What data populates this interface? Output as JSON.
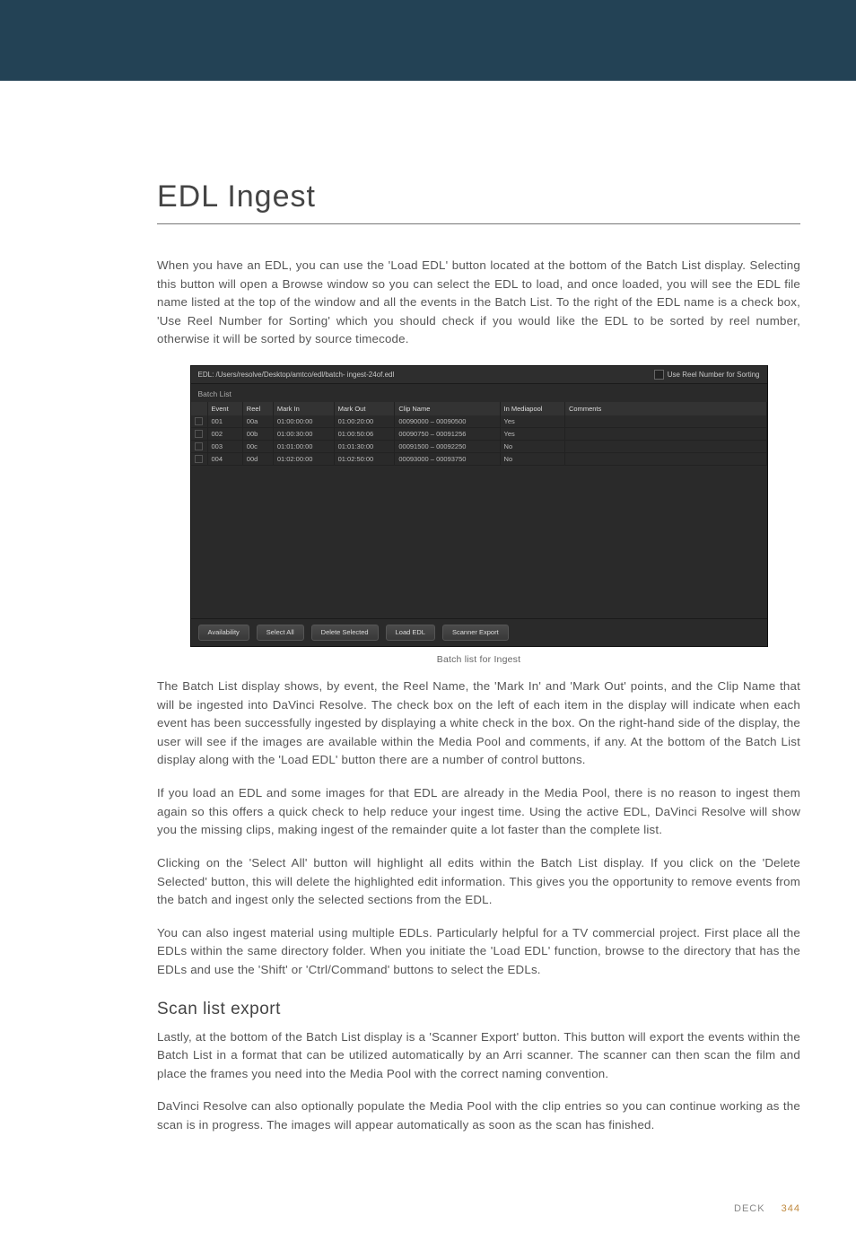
{
  "title": "EDL Ingest",
  "para1": "When you have an EDL, you can use the 'Load EDL' button located at the bottom of the Batch List display. Selecting this button will open a Browse window so you can select the EDL to load, and once loaded, you will see the EDL file name listed at the top of the window and all the events in the Batch List. To the right of the EDL name is a check box, 'Use Reel Number for Sorting' which you should check if you would like the EDL to be sorted by reel number, otherwise it will be sorted by source timecode.",
  "caption": "Batch list for Ingest",
  "para2": "The Batch List display shows, by event, the Reel Name, the 'Mark In' and 'Mark Out' points, and the Clip Name that will be ingested into DaVinci Resolve. The check box on the left of each item in the display will indicate when each event has been successfully ingested by displaying a white check in the box. On the right-hand side of the display, the user will see if the images are available within the Media Pool and comments, if any. At the bottom of the Batch List display along with the 'Load EDL' button there are a number of control buttons.",
  "para3": "If you load an EDL and some images for that EDL are already in the Media Pool, there is no reason to ingest them again so this offers a quick check to help reduce your ingest time. Using the active EDL, DaVinci Resolve will show you the missing clips, making ingest of the remainder quite a lot faster than the complete list.",
  "para4": "Clicking on the 'Select All' button will highlight all edits within the Batch List display. If you click on the 'Delete Selected' button, this will delete the highlighted edit information. This gives you the opportunity to remove events from the batch and ingest only the selected sections from the EDL.",
  "para5": "You can also ingest material using multiple EDLs. Particularly helpful for a TV commercial project. First place all the EDLs within the same directory folder. When you initiate the 'Load EDL' function, browse to the directory that has the EDLs and use the 'Shift' or 'Ctrl/Command' buttons to select the EDLs.",
  "subhead": "Scan list export",
  "para6": "Lastly, at the bottom of the Batch List display is a 'Scanner Export' button. This button will export the events within the Batch List in a format that can be utilized automatically by an Arri scanner. The scanner can then scan the film and place the frames you need into the Media Pool with the correct naming convention.",
  "para7": "DaVinci Resolve can also optionally populate the Media Pool with the clip entries so you can continue working as the scan is in progress. The images will appear automatically as soon as the scan has finished.",
  "footer": {
    "section": "DECK",
    "page": "344"
  },
  "shot": {
    "path_label": "EDL:  /Users/resolve/Desktop/amtco/edl/batch- ingest-24of.edl",
    "sort_label": "Use Reel Number for Sorting",
    "list_title": "Batch List",
    "headers": [
      "",
      "Event",
      "Reel",
      "Mark In",
      "Mark Out",
      "Clip Name",
      "In Mediapool",
      "Comments"
    ],
    "rows": [
      {
        "event": "001",
        "reel": "00a",
        "in": "01:00:00:00",
        "out": "01:00:20:00",
        "clip": "00090000 – 00090500",
        "pool": "Yes",
        "comments": ""
      },
      {
        "event": "002",
        "reel": "00b",
        "in": "01:00:30:00",
        "out": "01:00:50:06",
        "clip": "00090750 – 00091256",
        "pool": "Yes",
        "comments": ""
      },
      {
        "event": "003",
        "reel": "00c",
        "in": "01:01:00:00",
        "out": "01:01:30:00",
        "clip": "00091500 – 00092250",
        "pool": "No",
        "comments": ""
      },
      {
        "event": "004",
        "reel": "00d",
        "in": "01:02:00:00",
        "out": "01:02:50:00",
        "clip": "00093000 – 00093750",
        "pool": "No",
        "comments": ""
      }
    ],
    "buttons": {
      "availability": "Availability",
      "select_all": "Select All",
      "delete_selected": "Delete Selected",
      "load_edl": "Load EDL",
      "scanner_export": "Scanner Export"
    }
  }
}
